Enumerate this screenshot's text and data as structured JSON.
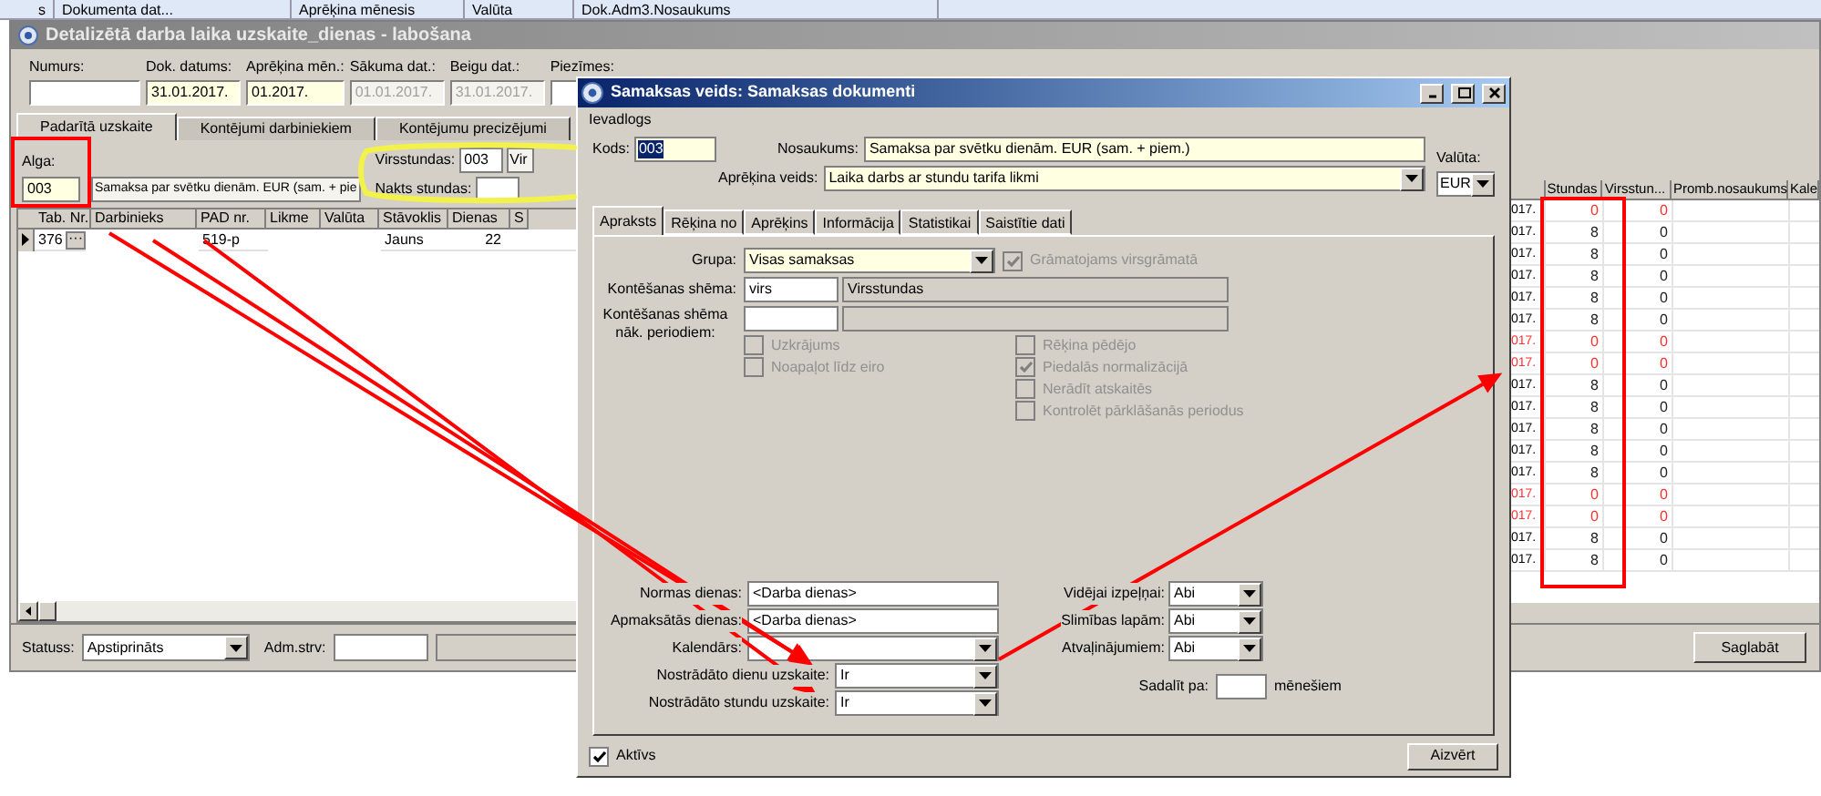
{
  "background_grid": {
    "columns": [
      "s",
      "Dokumenta dat...",
      "Aprēķina mēnesis",
      "Valūta",
      "Dok.Adm3.Nosaukums"
    ]
  },
  "main_window": {
    "title": "Detalizētā darba laika uzskaite_dienas - labošana",
    "fields": [
      {
        "label": "Numurs:",
        "disabled": false
      },
      {
        "label": "Dok. datums:",
        "value": "31.01.2017.",
        "disabled": false
      },
      {
        "label": "Aprēķina mēn.:",
        "value": "01.2017.",
        "disabled": false
      },
      {
        "label": "Sākuma dat.:",
        "value": "01.01.2017.",
        "disabled": true
      },
      {
        "label": "Beigu dat.:",
        "value": "31.01.2017.",
        "disabled": true
      },
      {
        "label": "Piezīmes:",
        "disabled": false
      }
    ],
    "tabs": [
      {
        "label": "Padarītā uzskaite",
        "selected": true
      },
      {
        "label": "Kontējumi darbiniekiem",
        "selected": false
      },
      {
        "label": "Kontējumu precizējumi",
        "selected": false
      }
    ],
    "alga": {
      "label": "Alga:",
      "code": "003",
      "name": "Samaksa par svētku dienām. EUR (sam. + pie"
    },
    "virsstundas": {
      "label": "Virsstundas:",
      "code": "003",
      "name": "Vir"
    },
    "nakts_stundas": {
      "label": "Nakts stundas:"
    },
    "table": {
      "columns": [
        "Tab. Nr.",
        "Darbinieks",
        "PAD nr.",
        "Likme",
        "Valūta",
        "Stāvoklis",
        "Dienas",
        "S"
      ],
      "rows": [
        {
          "tab_nr": "376",
          "button": "···",
          "pad_nr": "519-p",
          "stavoklis": "Jauns",
          "dienas": "22",
          "current": true
        }
      ]
    },
    "day_table": {
      "columns": [
        "Stundas",
        "Virsstun...",
        "Promb.nosaukums",
        "Kale"
      ],
      "rows": [
        {
          "date": "017.",
          "stundas": "0",
          "virsstundas": "0",
          "highlighted": true,
          "date_highlighted": false
        },
        {
          "date": "017.",
          "stundas": "8",
          "virsstundas": "0",
          "highlighted": false,
          "date_highlighted": false
        },
        {
          "date": "017.",
          "stundas": "8",
          "virsstundas": "0",
          "highlighted": false,
          "date_highlighted": false
        },
        {
          "date": "017.",
          "stundas": "8",
          "virsstundas": "0",
          "highlighted": false,
          "date_highlighted": false
        },
        {
          "date": "017.",
          "stundas": "8",
          "virsstundas": "0",
          "highlighted": false,
          "date_highlighted": false
        },
        {
          "date": "017.",
          "stundas": "8",
          "virsstundas": "0",
          "highlighted": false,
          "date_highlighted": false
        },
        {
          "date": "017.",
          "stundas": "0",
          "virsstundas": "0",
          "highlighted": true,
          "date_highlighted": true
        },
        {
          "date": "017.",
          "stundas": "0",
          "virsstundas": "0",
          "highlighted": true,
          "date_highlighted": true
        },
        {
          "date": "017.",
          "stundas": "8",
          "virsstundas": "0",
          "highlighted": false,
          "date_highlighted": false
        },
        {
          "date": "017.",
          "stundas": "8",
          "virsstundas": "0",
          "highlighted": false,
          "date_highlighted": false
        },
        {
          "date": "017.",
          "stundas": "8",
          "virsstundas": "0",
          "highlighted": false,
          "date_highlighted": false
        },
        {
          "date": "017.",
          "stundas": "8",
          "virsstundas": "0",
          "highlighted": false,
          "date_highlighted": false
        },
        {
          "date": "017.",
          "stundas": "8",
          "virsstundas": "0",
          "highlighted": false,
          "date_highlighted": false
        },
        {
          "date": "017.",
          "stundas": "0",
          "virsstundas": "0",
          "highlighted": true,
          "date_highlighted": true
        },
        {
          "date": "017.",
          "stundas": "0",
          "virsstundas": "0",
          "highlighted": true,
          "date_highlighted": true
        },
        {
          "date": "017.",
          "stundas": "8",
          "virsstundas": "0",
          "highlighted": false,
          "date_highlighted": false
        },
        {
          "date": "017.",
          "stundas": "8",
          "virsstundas": "0",
          "highlighted": false,
          "date_highlighted": false
        }
      ]
    },
    "status": {
      "label": "Statuss:",
      "value": "Apstiprināts"
    },
    "adm": {
      "label": "Adm.strv:"
    },
    "save_button": "Saglabāt"
  },
  "dialog": {
    "title": "Samaksas veids: Samaksas dokumenti",
    "menu": [
      "Ievadlogs"
    ],
    "kods": {
      "label": "Kods:",
      "value": "003"
    },
    "nosaukums": {
      "label": "Nosaukums:",
      "value": "Samaksa par svētku dienām. EUR (sam. + piem.)"
    },
    "aprekina_veids": {
      "label": "Aprēķina veids:",
      "value": "Laika darbs ar stundu tarifa likmi"
    },
    "valuta": {
      "label": "Valūta:",
      "value": "EUR"
    },
    "tabs": [
      {
        "label": "Apraksts",
        "selected": true
      },
      {
        "label": "Rēķina no",
        "selected": false
      },
      {
        "label": "Aprēķins",
        "selected": false
      },
      {
        "label": "Informācija",
        "selected": false
      },
      {
        "label": "Statistikai",
        "selected": false
      },
      {
        "label": "Saistītie dati",
        "selected": false
      }
    ],
    "grupa": {
      "label": "Grupa:",
      "value": "Visas samaksas"
    },
    "gramatojams": {
      "label": "Grāmatojams virsgrāmatā",
      "checked": true
    },
    "kontesanas": {
      "label": "Kontēšanas shēma:",
      "code": "virs",
      "name": "Virsstundas"
    },
    "kontesanas_nak": {
      "label": "Kontēšanas shēma nāk. periodiem:"
    },
    "checks_left": [
      {
        "label": "Uzkrājums",
        "checked": false
      },
      {
        "label": "Noapaļot līdz eiro",
        "checked": false
      }
    ],
    "checks_right": [
      {
        "label": "Rēķina pēdējo",
        "checked": false
      },
      {
        "label": "Piedalās normalizācijā",
        "checked": true
      },
      {
        "label": "Nerādīt atskaitēs",
        "checked": false
      },
      {
        "label": "Kontrolēt pārklāšanās periodus",
        "checked": false
      }
    ],
    "fields_left": [
      {
        "label": "Normas dienas:",
        "value": "<Darba dienas>",
        "kind": "text"
      },
      {
        "label": "Apmaksātās dienas:",
        "value": "<Darba dienas>",
        "kind": "text"
      },
      {
        "label": "Kalendārs:",
        "kind": "dropdown"
      },
      {
        "label": "Nostrādāto dienu uzskaite:",
        "value": "Ir",
        "kind": "short_dropdown"
      },
      {
        "label": "Nostrādāto stundu uzskaite:",
        "value": "Ir",
        "kind": "short_dropdown"
      }
    ],
    "fields_right": [
      {
        "label": "Vidējai izpeļņai:",
        "value": "Abi"
      },
      {
        "label": "Slimības lapām:",
        "value": "Abi"
      },
      {
        "label": "Atvaļinājumiem:",
        "value": "Abi"
      }
    ],
    "sadalit": {
      "label": "Sadalīt pa:",
      "suffix": "mēnešiem"
    },
    "aktivs": {
      "label": "Aktīvs",
      "checked": true
    },
    "close_button": "Aizvērt"
  }
}
